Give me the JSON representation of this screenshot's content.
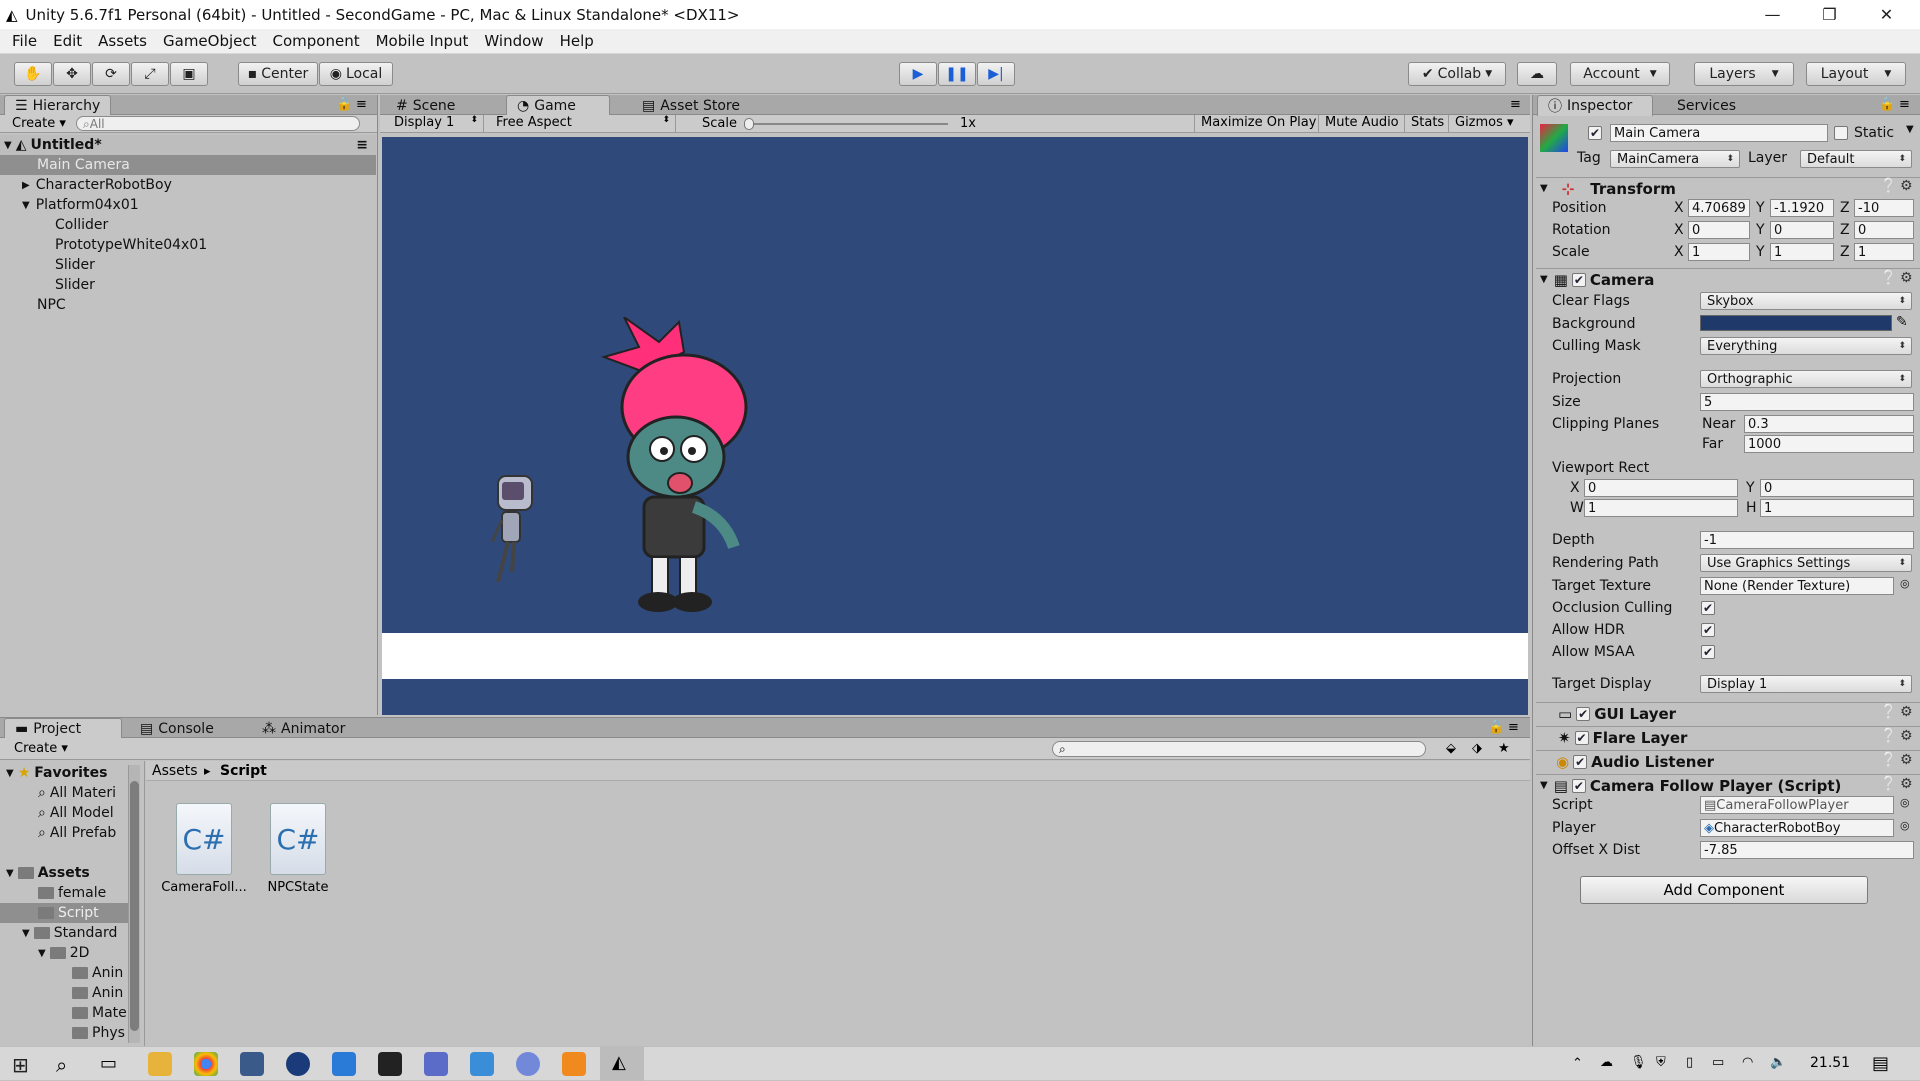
{
  "window": {
    "title": "Unity 5.6.7f1 Personal (64bit) - Untitled - SecondGame - PC, Mac & Linux Standalone* <DX11>",
    "minimize": "—",
    "restore": "❐",
    "close": "✕"
  },
  "menu": [
    "File",
    "Edit",
    "Assets",
    "GameObject",
    "Component",
    "Mobile Input",
    "Window",
    "Help"
  ],
  "toolbar": {
    "center": "Center",
    "local": "Local",
    "collab": "Collab",
    "account": "Account",
    "layers": "Layers",
    "layout": "Layout"
  },
  "hierarchy": {
    "tab": "Hierarchy",
    "create": "Create",
    "search_placeholder": "All",
    "scene": "Untitled*",
    "items": [
      "Main Camera",
      "CharacterRobotBoy",
      "Platform04x01",
      "Collider",
      "PrototypeWhite04x01",
      "Slider",
      "Slider",
      "NPC"
    ]
  },
  "game": {
    "tabs": [
      "Scene",
      "Game",
      "Asset Store"
    ],
    "display": "Display 1",
    "aspect": "Free Aspect",
    "scale_label": "Scale",
    "scale_value": "1x",
    "buttons": [
      "Maximize On Play",
      "Mute Audio",
      "Stats",
      "Gizmos"
    ],
    "background_color": "#2f4a7a"
  },
  "project": {
    "tabs": [
      "Project",
      "Console",
      "Animator"
    ],
    "create": "Create",
    "favorites_label": "Favorites",
    "favorites": [
      "All Materi",
      "All Model",
      "All Prefab"
    ],
    "assets_label": "Assets",
    "folders": [
      "female",
      "Script",
      "Standard",
      "2D",
      "Anin",
      "Anin",
      "Mate",
      "Phys"
    ],
    "breadcrumb": [
      "Assets",
      "Script"
    ],
    "files": [
      "CameraFoll...",
      "NPCState"
    ]
  },
  "inspector": {
    "tabs": [
      "Inspector",
      "Services"
    ],
    "object_name": "Main Camera",
    "static_label": "Static",
    "tag_label": "Tag",
    "tag": "MainCamera",
    "layer_label": "Layer",
    "layer": "Default",
    "transform": {
      "title": "Transform",
      "position_label": "Position",
      "rotation_label": "Rotation",
      "scale_label": "Scale",
      "position": [
        "4.70689",
        "-1.1920",
        "-10"
      ],
      "rotation": [
        "0",
        "0",
        "0"
      ],
      "scale": [
        "1",
        "1",
        "1"
      ]
    },
    "camera": {
      "title": "Camera",
      "clear_flags_label": "Clear Flags",
      "clear_flags": "Skybox",
      "background_label": "Background",
      "background_color": "#1f3a6a",
      "culling_mask_label": "Culling Mask",
      "culling_mask": "Everything",
      "projection_label": "Projection",
      "projection": "Orthographic",
      "size_label": "Size",
      "size": "5",
      "clipping_label": "Clipping Planes",
      "near_label": "Near",
      "near": "0.3",
      "far_label": "Far",
      "far": "1000",
      "viewport_label": "Viewport Rect",
      "vx": "0",
      "vy": "0",
      "vw": "1",
      "vh": "1",
      "depth_label": "Depth",
      "depth": "-1",
      "rendering_path_label": "Rendering Path",
      "rendering_path": "Use Graphics Settings",
      "target_texture_label": "Target Texture",
      "target_texture": "None (Render Texture)",
      "occlusion_label": "Occlusion Culling",
      "hdr_label": "Allow HDR",
      "msaa_label": "Allow MSAA",
      "target_display_label": "Target Display",
      "target_display": "Display 1"
    },
    "components": [
      "GUI Layer",
      "Flare Layer",
      "Audio Listener",
      "Camera Follow Player (Script)"
    ],
    "script": {
      "script_label": "Script",
      "script": "CameraFollowPlayer",
      "player_label": "Player",
      "player": "CharacterRobotBoy",
      "offset_label": "Offset X Dist",
      "offset": "-7.85"
    },
    "add_component": "Add Component"
  },
  "taskbar": {
    "time": "21.51"
  }
}
